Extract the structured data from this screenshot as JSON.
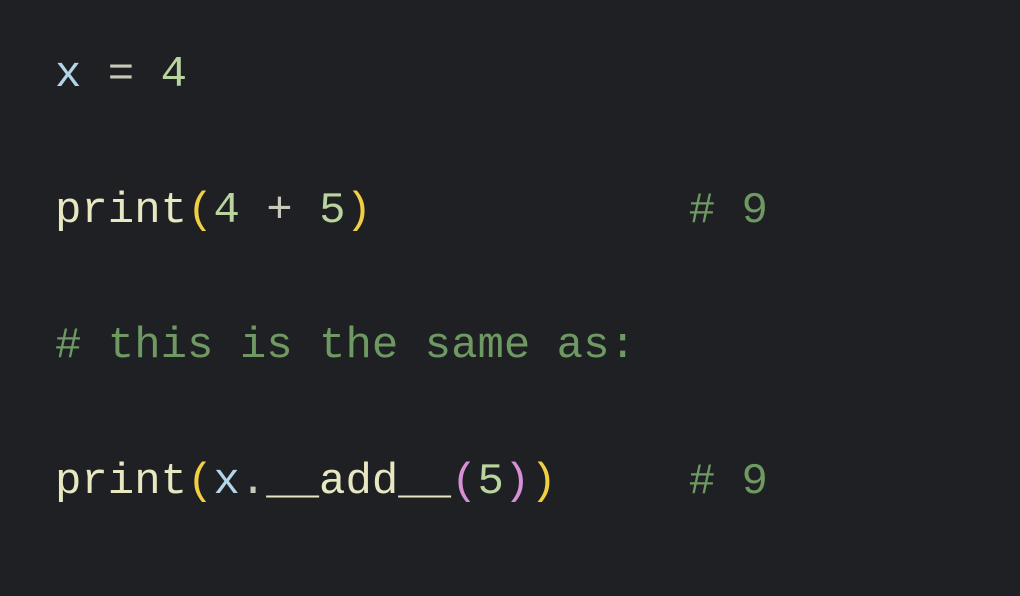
{
  "code": {
    "line1": {
      "var": "x",
      "op": " = ",
      "num": "4"
    },
    "line2": {
      "func": "print",
      "lparen": "(",
      "num1": "4",
      "op": " + ",
      "num2": "5",
      "rparen": ")",
      "pad": "            ",
      "comment": "# 9"
    },
    "line3": {
      "comment": "# this is the same as:"
    },
    "line4": {
      "func": "print",
      "lparen": "(",
      "var": "x",
      "dot": ".",
      "method": "__add__",
      "lparen2": "(",
      "num": "5",
      "rparen2": ")",
      "rparen": ")",
      "pad": "     ",
      "comment": "# 9"
    }
  }
}
